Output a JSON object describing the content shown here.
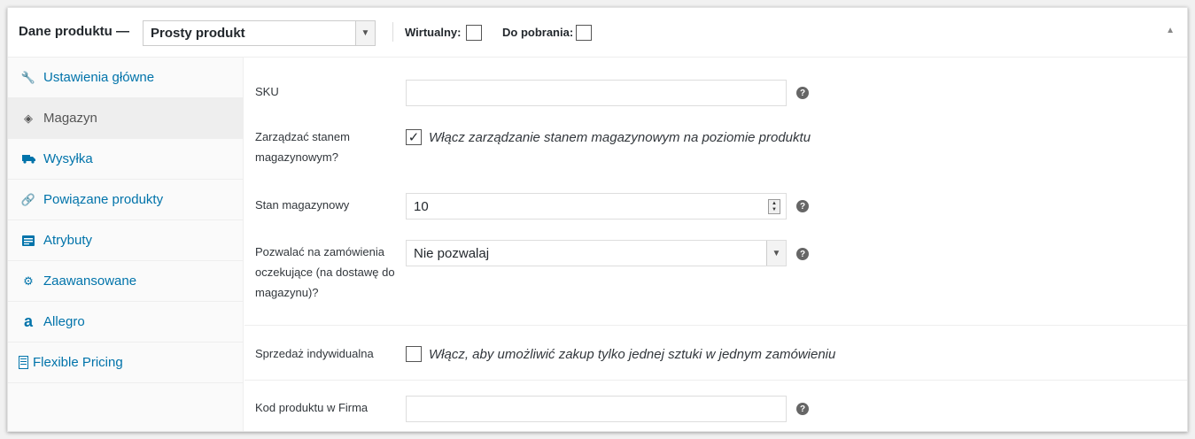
{
  "header": {
    "title": "Dane produktu —",
    "product_type": "Prosty produkt",
    "virtual_label": "Wirtualny:",
    "downloadable_label": "Do pobrania:"
  },
  "tabs": [
    {
      "label": "Ustawienia główne",
      "icon": "wrench-icon"
    },
    {
      "label": "Magazyn",
      "icon": "tag-icon",
      "active": true
    },
    {
      "label": "Wysyłka",
      "icon": "truck-icon"
    },
    {
      "label": "Powiązane produkty",
      "icon": "link-icon"
    },
    {
      "label": "Atrybuty",
      "icon": "list-icon"
    },
    {
      "label": "Zaawansowane",
      "icon": "gear-icon"
    },
    {
      "label": "Allegro",
      "icon": "allegro-icon"
    },
    {
      "label": "Flexible Pricing",
      "icon": "document-icon"
    }
  ],
  "fields": {
    "sku": {
      "label": "SKU",
      "value": ""
    },
    "manage_stock": {
      "label": "Zarządzać stanem magazynowym?",
      "checked": true,
      "description": "Włącz zarządzanie stanem magazynowym na poziomie produktu"
    },
    "stock_qty": {
      "label": "Stan magazynowy",
      "value": "10"
    },
    "backorders": {
      "label": "Pozwalać na zamówienia oczekujące (na dostawę do magazynu)?",
      "value": "Nie pozwalaj"
    },
    "sold_individually": {
      "label": "Sprzedaż indywidualna",
      "checked": false,
      "description": "Włącz, aby umożliwić zakup tylko jednej sztuki w jednym zamówieniu"
    },
    "product_code": {
      "label": "Kod produktu w Firma",
      "value": ""
    }
  },
  "colors": {
    "link": "#0073aa",
    "active_tab_bg": "#eeeeee"
  }
}
